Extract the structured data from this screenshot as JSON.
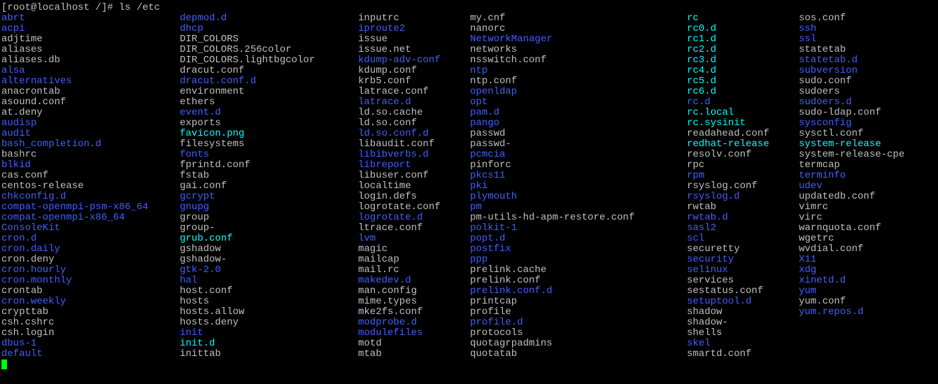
{
  "prompt": "[root@localhost /]# ls /etc",
  "columns": [
    [
      {
        "name": "abrt",
        "c": "dir"
      },
      {
        "name": "acpi",
        "c": "dir"
      },
      {
        "name": "adjtime",
        "c": "file"
      },
      {
        "name": "aliases",
        "c": "file"
      },
      {
        "name": "aliases.db",
        "c": "file"
      },
      {
        "name": "alsa",
        "c": "dir"
      },
      {
        "name": "alternatives",
        "c": "dir"
      },
      {
        "name": "anacrontab",
        "c": "file"
      },
      {
        "name": "asound.conf",
        "c": "file"
      },
      {
        "name": "at.deny",
        "c": "file"
      },
      {
        "name": "audisp",
        "c": "dir"
      },
      {
        "name": "audit",
        "c": "dir"
      },
      {
        "name": "bash_completion.d",
        "c": "dir"
      },
      {
        "name": "bashrc",
        "c": "file"
      },
      {
        "name": "blkid",
        "c": "dir"
      },
      {
        "name": "cas.conf",
        "c": "file"
      },
      {
        "name": "centos-release",
        "c": "file"
      },
      {
        "name": "chkconfig.d",
        "c": "dir"
      },
      {
        "name": "compat-openmpi-psm-x86_64",
        "c": "dir"
      },
      {
        "name": "compat-openmpi-x86_64",
        "c": "dir"
      },
      {
        "name": "ConsoleKit",
        "c": "dir"
      },
      {
        "name": "cron.d",
        "c": "dir"
      },
      {
        "name": "cron.daily",
        "c": "dir"
      },
      {
        "name": "cron.deny",
        "c": "file"
      },
      {
        "name": "cron.hourly",
        "c": "dir"
      },
      {
        "name": "cron.monthly",
        "c": "dir"
      },
      {
        "name": "crontab",
        "c": "file"
      },
      {
        "name": "cron.weekly",
        "c": "dir"
      },
      {
        "name": "crypttab",
        "c": "file"
      },
      {
        "name": "csh.cshrc",
        "c": "file"
      },
      {
        "name": "csh.login",
        "c": "file"
      },
      {
        "name": "dbus-1",
        "c": "dir"
      },
      {
        "name": "default",
        "c": "dir"
      }
    ],
    [
      {
        "name": "depmod.d",
        "c": "dir"
      },
      {
        "name": "dhcp",
        "c": "dir"
      },
      {
        "name": "DIR_COLORS",
        "c": "file"
      },
      {
        "name": "DIR_COLORS.256color",
        "c": "file"
      },
      {
        "name": "DIR_COLORS.lightbgcolor",
        "c": "file"
      },
      {
        "name": "dracut.conf",
        "c": "file"
      },
      {
        "name": "dracut.conf.d",
        "c": "dir"
      },
      {
        "name": "environment",
        "c": "file"
      },
      {
        "name": "ethers",
        "c": "file"
      },
      {
        "name": "event.d",
        "c": "dir"
      },
      {
        "name": "exports",
        "c": "file"
      },
      {
        "name": "favicon.png",
        "c": "link"
      },
      {
        "name": "filesystems",
        "c": "file"
      },
      {
        "name": "fonts",
        "c": "dir"
      },
      {
        "name": "fprintd.conf",
        "c": "file"
      },
      {
        "name": "fstab",
        "c": "file"
      },
      {
        "name": "gai.conf",
        "c": "file"
      },
      {
        "name": "gcrypt",
        "c": "dir"
      },
      {
        "name": "gnupg",
        "c": "dir"
      },
      {
        "name": "group",
        "c": "file"
      },
      {
        "name": "group-",
        "c": "file"
      },
      {
        "name": "grub.conf",
        "c": "link"
      },
      {
        "name": "gshadow",
        "c": "file"
      },
      {
        "name": "gshadow-",
        "c": "file"
      },
      {
        "name": "gtk-2.0",
        "c": "dir"
      },
      {
        "name": "hal",
        "c": "dir"
      },
      {
        "name": "host.conf",
        "c": "file"
      },
      {
        "name": "hosts",
        "c": "file"
      },
      {
        "name": "hosts.allow",
        "c": "file"
      },
      {
        "name": "hosts.deny",
        "c": "file"
      },
      {
        "name": "init",
        "c": "dir"
      },
      {
        "name": "init.d",
        "c": "link"
      },
      {
        "name": "inittab",
        "c": "file"
      }
    ],
    [
      {
        "name": "inputrc",
        "c": "file"
      },
      {
        "name": "iproute2",
        "c": "dir"
      },
      {
        "name": "issue",
        "c": "file"
      },
      {
        "name": "issue.net",
        "c": "file"
      },
      {
        "name": "kdump-adv-conf",
        "c": "dir"
      },
      {
        "name": "kdump.conf",
        "c": "file"
      },
      {
        "name": "krb5.conf",
        "c": "file"
      },
      {
        "name": "latrace.conf",
        "c": "file"
      },
      {
        "name": "latrace.d",
        "c": "dir"
      },
      {
        "name": "ld.so.cache",
        "c": "file"
      },
      {
        "name": "ld.so.conf",
        "c": "file"
      },
      {
        "name": "ld.so.conf.d",
        "c": "dir"
      },
      {
        "name": "libaudit.conf",
        "c": "file"
      },
      {
        "name": "libibverbs.d",
        "c": "dir"
      },
      {
        "name": "libreport",
        "c": "dir"
      },
      {
        "name": "libuser.conf",
        "c": "file"
      },
      {
        "name": "localtime",
        "c": "file"
      },
      {
        "name": "login.defs",
        "c": "file"
      },
      {
        "name": "logrotate.conf",
        "c": "file"
      },
      {
        "name": "logrotate.d",
        "c": "dir"
      },
      {
        "name": "ltrace.conf",
        "c": "file"
      },
      {
        "name": "lvm",
        "c": "dir"
      },
      {
        "name": "magic",
        "c": "file"
      },
      {
        "name": "mailcap",
        "c": "file"
      },
      {
        "name": "mail.rc",
        "c": "file"
      },
      {
        "name": "makedev.d",
        "c": "dir"
      },
      {
        "name": "man.config",
        "c": "file"
      },
      {
        "name": "mime.types",
        "c": "file"
      },
      {
        "name": "mke2fs.conf",
        "c": "file"
      },
      {
        "name": "modprobe.d",
        "c": "dir"
      },
      {
        "name": "modulefiles",
        "c": "dir"
      },
      {
        "name": "motd",
        "c": "file"
      },
      {
        "name": "mtab",
        "c": "file"
      }
    ],
    [
      {
        "name": "my.cnf",
        "c": "file"
      },
      {
        "name": "nanorc",
        "c": "file"
      },
      {
        "name": "NetworkManager",
        "c": "dir"
      },
      {
        "name": "networks",
        "c": "file"
      },
      {
        "name": "nsswitch.conf",
        "c": "file"
      },
      {
        "name": "ntp",
        "c": "dir"
      },
      {
        "name": "ntp.conf",
        "c": "file"
      },
      {
        "name": "openldap",
        "c": "dir"
      },
      {
        "name": "opt",
        "c": "dir"
      },
      {
        "name": "pam.d",
        "c": "dir"
      },
      {
        "name": "pango",
        "c": "dir"
      },
      {
        "name": "passwd",
        "c": "file"
      },
      {
        "name": "passwd-",
        "c": "file"
      },
      {
        "name": "pcmcia",
        "c": "dir"
      },
      {
        "name": "pinforc",
        "c": "file"
      },
      {
        "name": "pkcs11",
        "c": "dir"
      },
      {
        "name": "pki",
        "c": "dir"
      },
      {
        "name": "plymouth",
        "c": "dir"
      },
      {
        "name": "pm",
        "c": "dir"
      },
      {
        "name": "pm-utils-hd-apm-restore.conf",
        "c": "file"
      },
      {
        "name": "polkit-1",
        "c": "dir"
      },
      {
        "name": "popt.d",
        "c": "dir"
      },
      {
        "name": "postfix",
        "c": "dir"
      },
      {
        "name": "ppp",
        "c": "dir"
      },
      {
        "name": "prelink.cache",
        "c": "file"
      },
      {
        "name": "prelink.conf",
        "c": "file"
      },
      {
        "name": "prelink.conf.d",
        "c": "dir"
      },
      {
        "name": "printcap",
        "c": "file"
      },
      {
        "name": "profile",
        "c": "file"
      },
      {
        "name": "profile.d",
        "c": "dir"
      },
      {
        "name": "protocols",
        "c": "file"
      },
      {
        "name": "quotagrpadmins",
        "c": "file"
      },
      {
        "name": "quotatab",
        "c": "file"
      }
    ],
    [
      {
        "name": "rc",
        "c": "link"
      },
      {
        "name": "rc0.d",
        "c": "link"
      },
      {
        "name": "rc1.d",
        "c": "link"
      },
      {
        "name": "rc2.d",
        "c": "link"
      },
      {
        "name": "rc3.d",
        "c": "link"
      },
      {
        "name": "rc4.d",
        "c": "link"
      },
      {
        "name": "rc5.d",
        "c": "link"
      },
      {
        "name": "rc6.d",
        "c": "link"
      },
      {
        "name": "rc.d",
        "c": "dir"
      },
      {
        "name": "rc.local",
        "c": "link"
      },
      {
        "name": "rc.sysinit",
        "c": "link"
      },
      {
        "name": "readahead.conf",
        "c": "file"
      },
      {
        "name": "redhat-release",
        "c": "link"
      },
      {
        "name": "resolv.conf",
        "c": "file"
      },
      {
        "name": "rpc",
        "c": "file"
      },
      {
        "name": "rpm",
        "c": "dir"
      },
      {
        "name": "rsyslog.conf",
        "c": "file"
      },
      {
        "name": "rsyslog.d",
        "c": "dir"
      },
      {
        "name": "rwtab",
        "c": "file"
      },
      {
        "name": "rwtab.d",
        "c": "dir"
      },
      {
        "name": "sasl2",
        "c": "dir"
      },
      {
        "name": "scl",
        "c": "dir"
      },
      {
        "name": "securetty",
        "c": "file"
      },
      {
        "name": "security",
        "c": "dir"
      },
      {
        "name": "selinux",
        "c": "dir"
      },
      {
        "name": "services",
        "c": "file"
      },
      {
        "name": "sestatus.conf",
        "c": "file"
      },
      {
        "name": "setuptool.d",
        "c": "dir"
      },
      {
        "name": "shadow",
        "c": "file"
      },
      {
        "name": "shadow-",
        "c": "file"
      },
      {
        "name": "shells",
        "c": "file"
      },
      {
        "name": "skel",
        "c": "dir"
      },
      {
        "name": "smartd.conf",
        "c": "file"
      }
    ],
    [
      {
        "name": "sos.conf",
        "c": "file"
      },
      {
        "name": "ssh",
        "c": "dir"
      },
      {
        "name": "ssl",
        "c": "dir"
      },
      {
        "name": "statetab",
        "c": "file"
      },
      {
        "name": "statetab.d",
        "c": "dir"
      },
      {
        "name": "subversion",
        "c": "dir"
      },
      {
        "name": "sudo.conf",
        "c": "file"
      },
      {
        "name": "sudoers",
        "c": "file"
      },
      {
        "name": "sudoers.d",
        "c": "dir"
      },
      {
        "name": "sudo-ldap.conf",
        "c": "file"
      },
      {
        "name": "sysconfig",
        "c": "dir"
      },
      {
        "name": "sysctl.conf",
        "c": "file"
      },
      {
        "name": "system-release",
        "c": "link"
      },
      {
        "name": "system-release-cpe",
        "c": "file"
      },
      {
        "name": "termcap",
        "c": "file"
      },
      {
        "name": "terminfo",
        "c": "dir"
      },
      {
        "name": "udev",
        "c": "dir"
      },
      {
        "name": "updatedb.conf",
        "c": "file"
      },
      {
        "name": "vimrc",
        "c": "file"
      },
      {
        "name": "virc",
        "c": "file"
      },
      {
        "name": "warnquota.conf",
        "c": "file"
      },
      {
        "name": "wgetrc",
        "c": "file"
      },
      {
        "name": "wvdial.conf",
        "c": "file"
      },
      {
        "name": "X11",
        "c": "dir"
      },
      {
        "name": "xdg",
        "c": "dir"
      },
      {
        "name": "xinetd.d",
        "c": "dir"
      },
      {
        "name": "yum",
        "c": "dir"
      },
      {
        "name": "yum.conf",
        "c": "file"
      },
      {
        "name": "yum.repos.d",
        "c": "dir"
      }
    ]
  ]
}
